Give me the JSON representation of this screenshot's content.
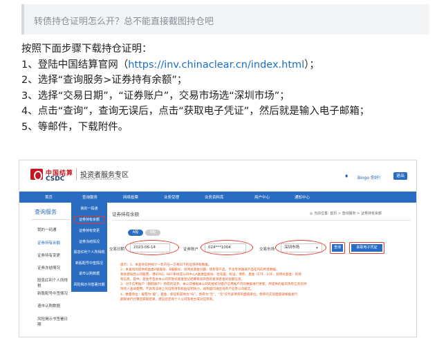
{
  "question": "转债持仓证明怎么开？总不能直接截图持仓吧",
  "steps": {
    "intro": "按照下面步骤下载持仓证明：",
    "s1_prefix": "1、登陆中国结算官网（",
    "s1_link": "https://inv.chinaclear.cn/index.html",
    "s1_suffix": "）；",
    "s2": "2、选择“查询服务>证券持有余额”；",
    "s3": "3、选择“交易日期”，“证券账户”，交易市场选“深圳市场”；",
    "s4": "4、点击“查询”，查询无误后，点击“获取电子凭证”，然后就是输入电子邮箱；",
    "s5": "5、等邮件，下载附件。"
  },
  "screenshot": {
    "logo_cn": "中国结算",
    "logo_en": "CSDC",
    "site_title": "投资者服务专区",
    "site_sub": "INVESTORS SERVICE AREA",
    "user": "Bingo 你好!",
    "logout": "退出",
    "nav": [
      "首页",
      "查询服务",
      "网络投票",
      "业务受理",
      "业务资料库",
      "用户中心",
      "通知中心"
    ],
    "dropdown": [
      "我的一码通",
      "证券持有余额",
      "证券持有变更",
      "证券冻结情况",
      "股息红利个人所得税",
      "新股配号中签情况",
      "退市认购数据",
      "风险揭示书签署日期"
    ],
    "sidebar_head": "查询服务",
    "sidebar": [
      "我的一码通",
      "证券持有余额",
      "证券持有变更",
      "证券冻结情况",
      "股息红利个人所得税",
      "新股配号中签情况",
      "退市认购数据",
      "风险揭示书签署日期"
    ],
    "main_title": "证券持有余额",
    "breadcrumb": "◎ 当前位置: 首页 > 查询服务 > 证券持有余额",
    "tab_a": "A股",
    "tab_b": "B股",
    "date_label": "交易日期",
    "date_value": "2023-06-14",
    "account_label": "证券账户",
    "account_value": "024***1004",
    "market_label": "交易市场",
    "market_value": "深圳市场",
    "query_btn": "查询",
    "voucher_btn": "获取电子凭证",
    "note_lines": [
      "提示：1、本查询仅供统计一年内任一交易日下的证券持有数据。",
      "2、本查询仅提供权益类A股股份、B股股份、封闭式基金份额、债券等产品，不含专项融资产品在内的所有数据。",
      "系统建设后公司股票、港STAQ、NET系统在公司中心A类类型股份、优先股、权证、债券、基金（ETF、LOF、封闭式基金）的持",
      "有信息，其中，基金不包含本公司开放式基金登记结算系统开放的投资基金的份额信息。",
      "3、对于信用账户（跟踪账户）持有的证券，本公司根据本公司的授权对客户信用账户内的数据进行更新，所提供的股东持有信息仅供",
      "持有人查阅使用，不具有法律上的证券持有权益证明效力，如有疑问请咨询开户证券公司核实。",
      "4、数量单位：股票为“股”，基金、权证和其他为“份”，债券为“元”，“元”仅代表债券的面值单位，债券的实际面值请根据发行",
      "期限进行计算后获取结果，建议您咨询个人公司等柜台或对应券商。"
    ]
  }
}
